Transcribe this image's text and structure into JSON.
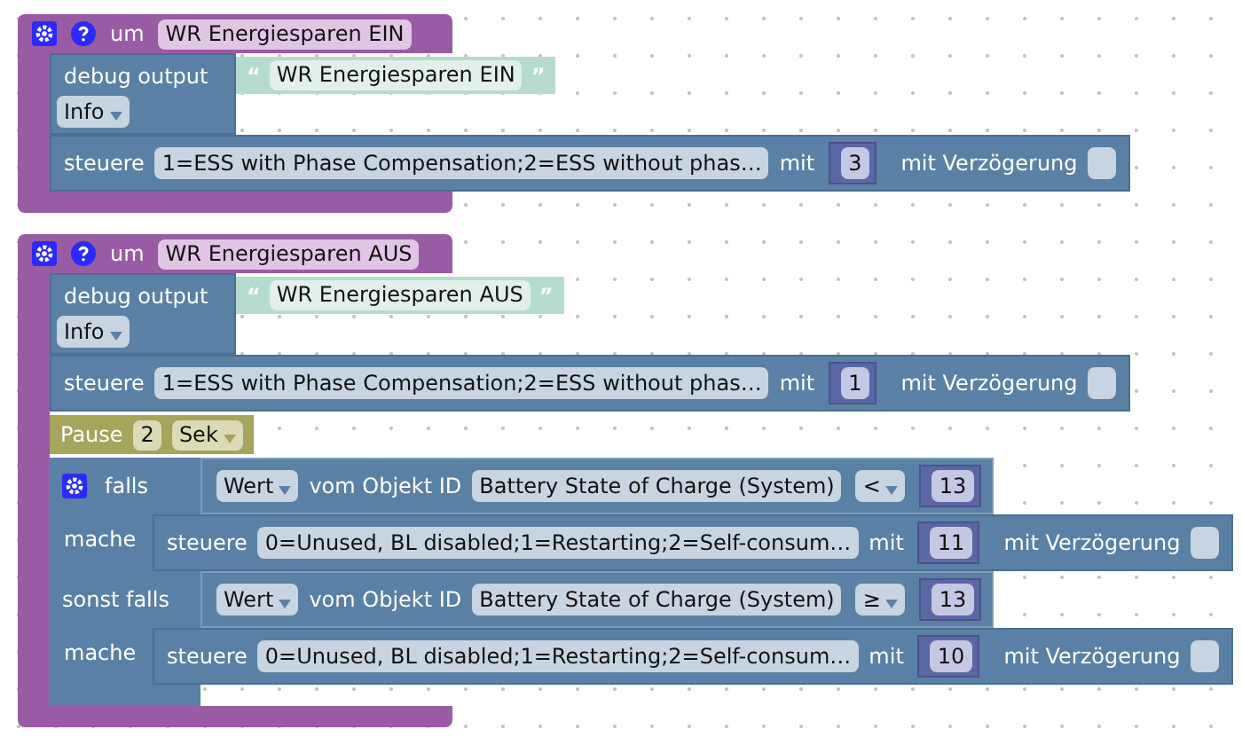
{
  "functions": [
    {
      "keyword": "um",
      "name": "WR Energiesparen EIN",
      "statements": [
        {
          "kind": "debug",
          "label": "debug output",
          "open_quote": "“",
          "text": "WR Energiesparen EIN",
          "close_quote": "”",
          "severity": "Info"
        },
        {
          "kind": "control",
          "label": "steuere",
          "target": "1=ESS with Phase Compensation;2=ESS without phas…",
          "with": "mit",
          "value": "3",
          "delay_label": "mit Verzögerung",
          "delay": false
        }
      ]
    },
    {
      "keyword": "um",
      "name": "WR Energiesparen AUS",
      "statements": [
        {
          "kind": "debug",
          "label": "debug output",
          "open_quote": "“",
          "text": "WR Energiesparen AUS",
          "close_quote": "”",
          "severity": "Info"
        },
        {
          "kind": "control",
          "label": "steuere",
          "target": "1=ESS with Phase Compensation;2=ESS without phas…",
          "with": "mit",
          "value": "1",
          "delay_label": "mit Verzögerung",
          "delay": false
        },
        {
          "kind": "pause",
          "label": "Pause",
          "value": "2",
          "unit": "Sek"
        },
        {
          "kind": "if",
          "branches": [
            {
              "label": "falls",
              "condition": {
                "mode": "Wert",
                "of": "vom Objekt ID",
                "object": "Battery State of Charge (System)",
                "op": "<",
                "value": "13"
              },
              "do_label": "mache",
              "statements": [
                {
                  "kind": "control",
                  "label": "steuere",
                  "target": "0=Unused, BL disabled;1=Restarting;2=Self-consum…",
                  "with": "mit",
                  "value": "11",
                  "delay_label": "mit Verzögerung",
                  "delay": false
                }
              ]
            },
            {
              "label": "sonst falls",
              "condition": {
                "mode": "Wert",
                "of": "vom Objekt ID",
                "object": "Battery State of Charge (System)",
                "op": "≥",
                "value": "13"
              },
              "do_label": "mache",
              "statements": [
                {
                  "kind": "control",
                  "label": "steuere",
                  "target": "0=Unused, BL disabled;1=Restarting;2=Self-consum…",
                  "with": "mit",
                  "value": "10",
                  "delay_label": "mit Verzögerung",
                  "delay": false
                }
              ]
            }
          ]
        }
      ]
    }
  ]
}
